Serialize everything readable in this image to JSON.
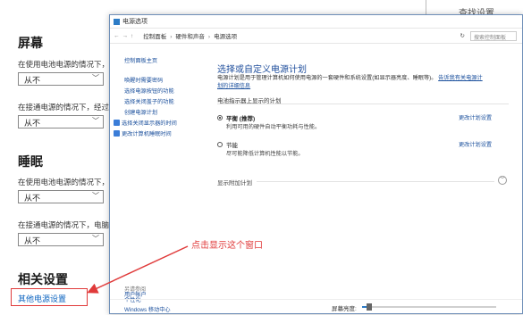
{
  "background": {
    "search_text": "查找设置",
    "screen_heading": "屏幕",
    "screen_battery_label": "在使用电池电源的情况下，",
    "screen_battery_value": "从不",
    "screen_plugged_label": "在接通电源的情况下，经过",
    "screen_plugged_value": "从不",
    "sleep_heading": "睡眠",
    "sleep_battery_label": "在使用电池电源的情况下，",
    "sleep_battery_value": "从不",
    "sleep_plugged_label": "在接通电源的情况下，电脑",
    "sleep_plugged_value": "从不",
    "related_heading": "相关设置",
    "other_power_link": "其他电源设置"
  },
  "annotation": {
    "text": "点击显示这个窗口",
    "color": "#e03a3a"
  },
  "window": {
    "title": "电源选项",
    "address": {
      "crumbs": [
        "控制面板",
        "硬件和声音",
        "电源选项"
      ],
      "search_placeholder": "搜索控制面板"
    },
    "left_nav": {
      "items": [
        "控制面板主页",
        "唤醒时需要密码",
        "选择电源按钮的功能",
        "选择关闭盖子的功能",
        "创建电源计划",
        "选择关闭显示器的时间",
        "更改计算机睡眠时间"
      ],
      "see_also_heading": "另请参阅",
      "see_also_items": [
        "个性化",
        "Windows 移动中心",
        "用户帐户"
      ]
    },
    "content": {
      "title": "选择或自定义电源计划",
      "description": "电源计划是用于管理计算机如何使用电源的一套硬件和系统设置(如显示器亮度、睡眠等)。",
      "description_link": "告诉我有关电源计划的详细信息",
      "section_label": "电池指示器上显示的计划",
      "plans": [
        {
          "name": "平衡 (推荐)",
          "desc": "利用可用的硬件自动平衡功耗与性能。",
          "link": "更改计划设置",
          "selected": true
        },
        {
          "name": "节能",
          "desc": "尽可能降低计算机性能以节能。",
          "link": "更改计划设置",
          "selected": false
        }
      ],
      "more_plans": "显示附加计划"
    },
    "brightness": {
      "label": "屏幕亮度:",
      "level_percent": 5
    }
  }
}
